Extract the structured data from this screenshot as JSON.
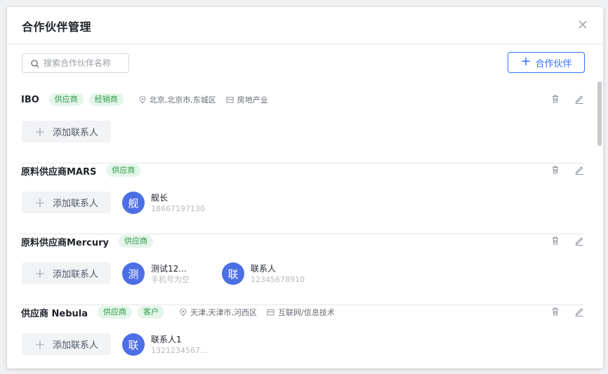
{
  "dialog": {
    "title": "合作伙伴管理"
  },
  "search": {
    "placeholder": "搜索合作伙伴名称"
  },
  "add_partner_label": "合作伙伴",
  "add_contact_label": "添加联系人",
  "partners": [
    {
      "name": "IBO",
      "tags": [
        "供应商",
        "经销商"
      ],
      "location": "北京,北京市,东城区",
      "industry": "房地产业",
      "contacts": []
    },
    {
      "name": "原料供应商MARS",
      "tags": [
        "供应商"
      ],
      "contacts": [
        {
          "avatar": "舰",
          "name": "舰长",
          "phone": "18667197130"
        }
      ]
    },
    {
      "name": "原料供应商Mercury",
      "tags": [
        "供应商"
      ],
      "contacts": [
        {
          "avatar": "测",
          "name": "测试12...",
          "phone": "手机号为空"
        },
        {
          "avatar": "联",
          "name": "联系人",
          "phone": "12345678910"
        }
      ]
    },
    {
      "name": "供应商 Nebula",
      "tags": [
        "供应商",
        "客户"
      ],
      "location": "天津,天津市,河西区",
      "industry": "互联网/信息技术",
      "contacts": [
        {
          "avatar": "联",
          "name": "联系人1",
          "phone": "1321234567..."
        }
      ]
    }
  ],
  "colors": {
    "accent": "#3370ff",
    "tag_text": "#2e9a4a",
    "tag_bg": "#e4f5e9",
    "avatar": "#4c6fe6"
  }
}
